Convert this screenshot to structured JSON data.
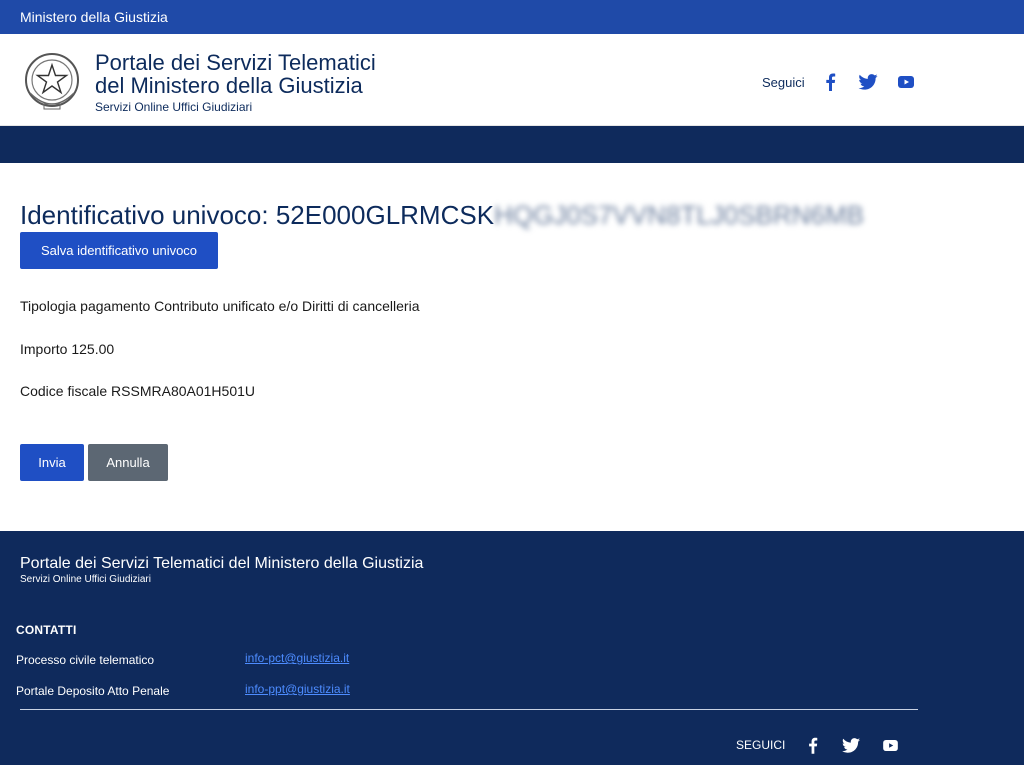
{
  "topbar": {
    "label": "Ministero della Giustizia"
  },
  "header": {
    "title_line1": "Portale dei Servizi Telematici",
    "title_line2": "del Ministero della Giustizia",
    "subtitle": "Servizi Online Uffici Giudiziari",
    "social_label": "Seguici",
    "icons": [
      "facebook-icon",
      "twitter-icon",
      "youtube-icon"
    ]
  },
  "main": {
    "uid_label": "Identificativo univoco:",
    "uid_value": "52E000GLRMCSK",
    "uid_hidden": "HQGJ0S7VVN8TLJ0SBRN6MB",
    "save_button": "Salva identificativo univoco",
    "tipologia": "Tipologia pagamento Contributo unificato e/o Diritti di cancelleria",
    "importo": "Importo 125.00",
    "codice_fiscale": "Codice fiscale RSSMRA80A01H501U",
    "send_button": "Invia",
    "cancel_button": "Annulla"
  },
  "footer": {
    "title": "Portale dei Servizi Telematici del Ministero della Giustizia",
    "subtitle": "Servizi Online Uffici Giudiziari",
    "contacts_heading": "CONTATTI",
    "contacts": [
      {
        "label": "Processo civile telematico",
        "email": "info-pct@giustizia.it"
      },
      {
        "label": "Portale Deposito Atto Penale",
        "email": "info-ppt@giustizia.it"
      }
    ],
    "social_label": "SEGUICI"
  },
  "colors": {
    "topbar": "#1f4aa8",
    "navy": "#0f2a5c",
    "primary_button": "#1f4fc4",
    "secondary_button": "#5c6773",
    "link": "#4d8cff"
  }
}
